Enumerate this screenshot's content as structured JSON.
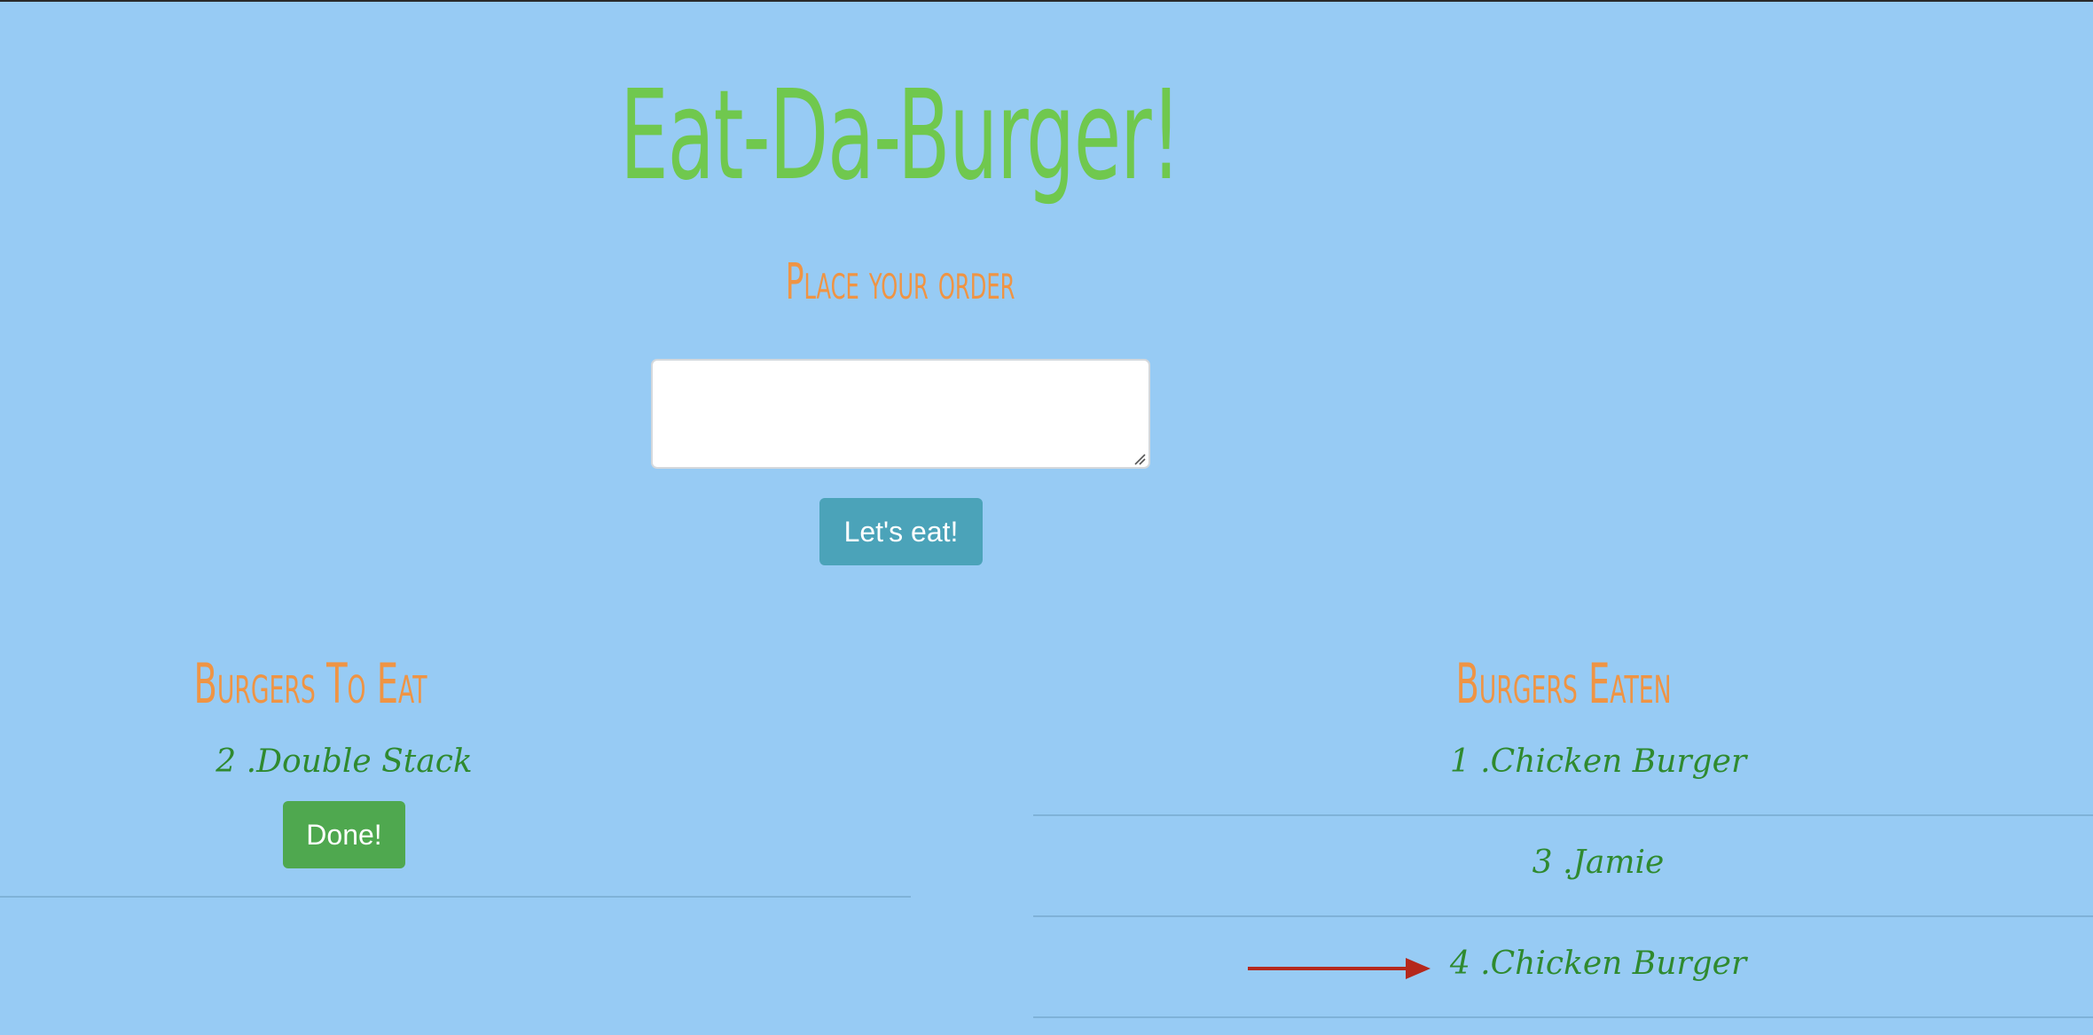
{
  "header": {
    "title": "Eat-Da-Burger!",
    "subtitle": "Place your order"
  },
  "order_form": {
    "input_value": "",
    "submit_label": "Let's eat!"
  },
  "to_eat": {
    "heading": "Burgers To Eat",
    "items": [
      {
        "label": "2 .Double Stack",
        "button_label": "Done!"
      }
    ]
  },
  "eaten": {
    "heading": "Burgers Eaten",
    "items": [
      {
        "label": "1 .Chicken Burger"
      },
      {
        "label": "3 .Jamie"
      },
      {
        "label": "4 .Chicken Burger"
      }
    ]
  },
  "colors": {
    "background": "#97cbf4",
    "title": "#70c84e",
    "headings": "#ef9444",
    "item_text": "#2f8a2f",
    "submit_button": "#4ba3b9",
    "done_button": "#4fa84f",
    "annotation_arrow": "#b5281c"
  },
  "icons": {
    "annotation": "arrow-right-icon",
    "textarea_resize": "resize-handle-icon"
  }
}
